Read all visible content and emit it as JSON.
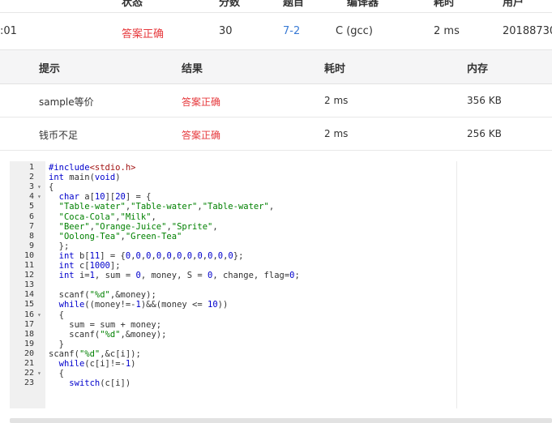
{
  "submission": {
    "headers": [
      "状态",
      "分数",
      "题目",
      "编译器",
      "耗时",
      "用户"
    ],
    "row": {
      "time_fragment": ":01",
      "status": "答案正确",
      "score": "30",
      "problem": "7-2",
      "compiler": "C (gcc)",
      "duration": "2 ms",
      "user": "20188730"
    }
  },
  "cases": {
    "headers": [
      "提示",
      "结果",
      "耗时",
      "内存"
    ],
    "rows": [
      {
        "hint": "sample等价",
        "result": "答案正确",
        "time": "2 ms",
        "memory": "356 KB"
      },
      {
        "hint": "钱币不足",
        "result": "答案正确",
        "time": "2 ms",
        "memory": "256 KB"
      }
    ]
  },
  "code": {
    "lines": [
      "#include<stdio.h>",
      "int main(void)",
      "{",
      "  char a[10][20] = {",
      "  \"Table-water\",\"Table-water\",\"Table-water\",",
      "  \"Coca-Cola\",\"Milk\",",
      "  \"Beer\",\"Orange-Juice\",\"Sprite\",",
      "  \"Oolong-Tea\",\"Green-Tea\"",
      "  };",
      "  int b[11] = {0,0,0,0,0,0,0,0,0,0,0};",
      "  int c[1000];",
      "  int i=1, sum = 0, money, S = 0, change, flag=0;",
      "",
      "  scanf(\"%d\",&money);",
      "  while((money!=-1)&&(money <= 10))",
      "  {",
      "    sum = sum + money;",
      "    scanf(\"%d\",&money);",
      "  }",
      "scanf(\"%d\",&c[i]);",
      "  while(c[i]!=-1)",
      "  {",
      "    switch(c[i])"
    ],
    "fold_marker": "▾"
  }
}
